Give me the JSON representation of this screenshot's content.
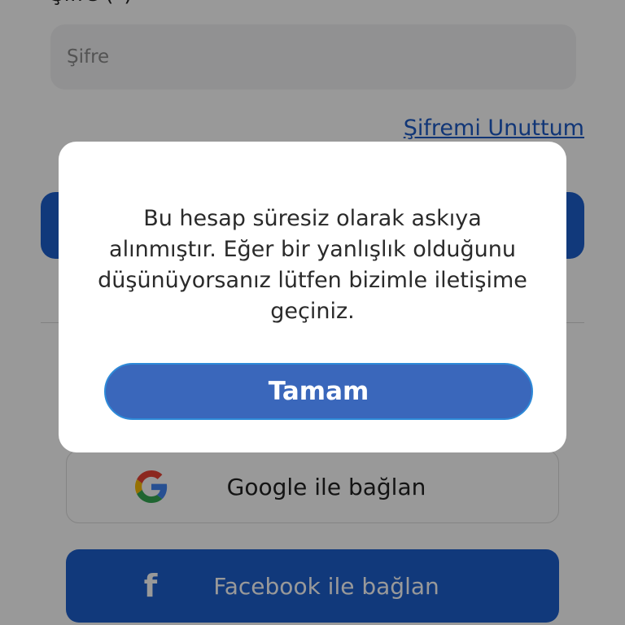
{
  "login_form": {
    "password_label": "Şifre (*)",
    "password_placeholder": "Şifre",
    "forgot_password": "Şifremi Unuttum",
    "google_button": "Google ile bağlan",
    "facebook_button": "Facebook ile bağlan"
  },
  "dialog": {
    "message": "Bu hesap süresiz olarak askıya alınmıştır. Eğer bir yanlışlık olduğunu düşünüyorsanız lütfen bizimle iletişime geçiniz.",
    "ok_label": "Tamam"
  },
  "icons": {
    "google": "google-logo-icon",
    "facebook": "facebook-logo-icon"
  },
  "colors": {
    "primary_blue": "#1d5fce",
    "dialog_button": "#3a67bb",
    "link": "#1d5bc7",
    "overlay": "rgba(0,0,0,0.40)"
  }
}
